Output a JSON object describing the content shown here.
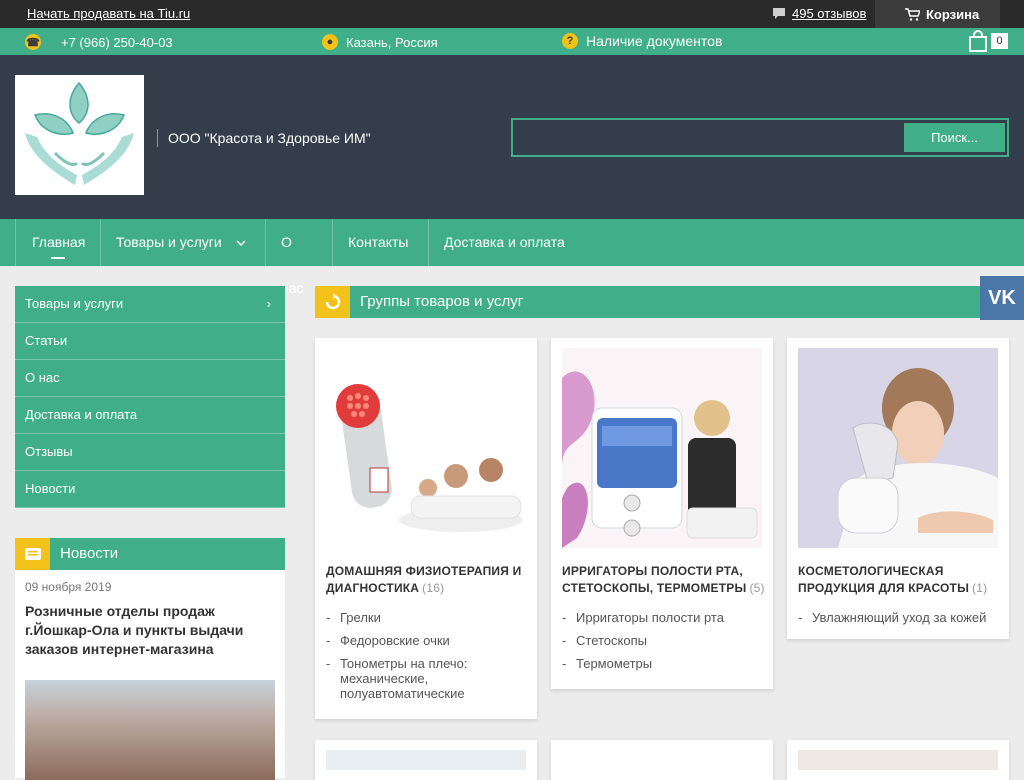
{
  "topbar": {
    "sell_link": "Начать продавать на Tiu.ru",
    "reviews": "495 отзывов",
    "cart": "Корзина"
  },
  "infobar": {
    "phone": "+7 (966) 250-40-03",
    "city": "Казань, Россия",
    "docs": "Наличие документов",
    "cart_count": "0"
  },
  "header": {
    "company": "ООО \"Красота и Здоровье ИМ\"",
    "search_button": "Поиск...",
    "search_placeholder": ""
  },
  "nav": {
    "items": [
      "Главная",
      "Товары и услуги",
      "О нас",
      "Контакты",
      "Доставка и оплата"
    ]
  },
  "sidebar": {
    "items": [
      "Товары и услуги",
      "Статьи",
      "О нас",
      "Доставка и оплата",
      "Отзывы",
      "Новости"
    ]
  },
  "news": {
    "header": "Новости",
    "date": "09 ноября 2019",
    "title": "Розничные отделы продаж г.Йошкар-Ола и пункты выдачи заказов интернет-магазина"
  },
  "groups": {
    "header": "Группы товаров и услуг",
    "cards": [
      {
        "title": "Домашняя физиотерапия и диагностика",
        "count": "(16)",
        "items": [
          "Грелки",
          "Федоровские очки",
          "Тонометры на плечо: механические, полуавтоматические"
        ]
      },
      {
        "title": "Ирригаторы полости рта, стетоскопы, термометры",
        "count": "(5)",
        "items": [
          "Ирригаторы полости рта",
          "Стетоскопы",
          "Термометры"
        ]
      },
      {
        "title": "Косметологическая продукция для красоты",
        "count": "(1)",
        "items": [
          "Увлажняющий уход за кожей"
        ]
      }
    ]
  },
  "social": {
    "vk": "VK"
  },
  "colors": {
    "accent": "#3fae89",
    "header_bg": "#333e4a",
    "topbar_bg": "#2a2a2a",
    "icon_yellow": "#f2c21b"
  }
}
